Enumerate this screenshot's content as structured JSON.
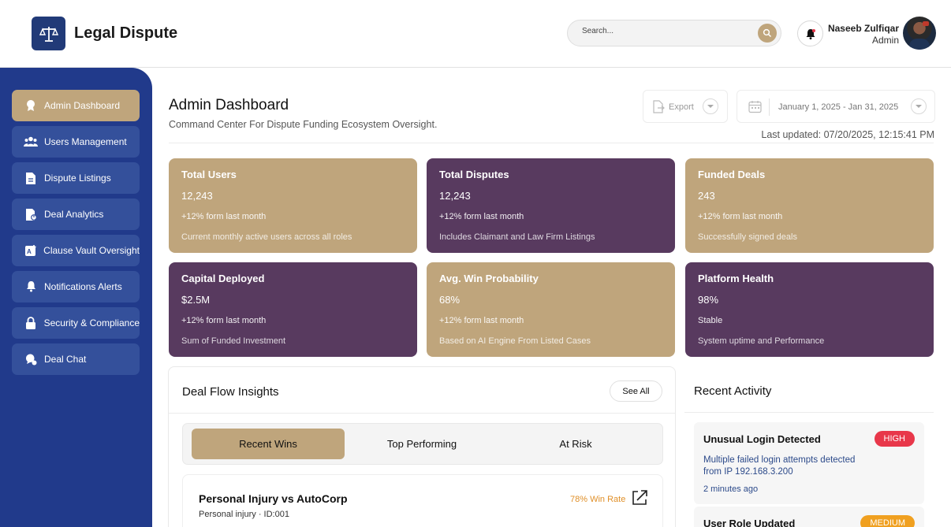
{
  "app": {
    "title": "Legal Dispute"
  },
  "header": {
    "search_placeholder": "Search...",
    "user_name": "Naseeb Zulfiqar",
    "user_role": "Admin"
  },
  "sidebar": {
    "items": [
      {
        "label": "Admin Dashboard",
        "icon": "badge-icon",
        "active": true
      },
      {
        "label": "Users Management",
        "icon": "users-icon"
      },
      {
        "label": "Dispute Listings",
        "icon": "document-icon"
      },
      {
        "label": "Deal Analytics",
        "icon": "analytics-icon"
      },
      {
        "label": "Clause Vault Oversight",
        "icon": "vault-icon"
      },
      {
        "label": "Notifications Alerts",
        "icon": "bell-icon"
      },
      {
        "label": "Security & Compliance",
        "icon": "lock-icon"
      },
      {
        "label": "Deal Chat",
        "icon": "chat-icon"
      }
    ]
  },
  "main": {
    "title": "Admin Dashboard",
    "subtitle": "Command Center For Dispute Funding Ecosystem Oversight.",
    "export_label": "Export",
    "date_range": "January 1, 2025 - Jan 31, 2025",
    "last_updated": "Last updated: 07/20/2025, 12:15:41 PM"
  },
  "cards": [
    {
      "title": "Total Users",
      "value": "12,243",
      "delta": "+12% form last month",
      "desc": "Current monthly active users across all roles",
      "color": "#bfa57c"
    },
    {
      "title": "Total Disputes",
      "value": "12,243",
      "delta": "+12% form last month",
      "desc": "Includes Claimant and Law Firm Listings",
      "color": "#583a5f"
    },
    {
      "title": "Funded Deals",
      "value": "243",
      "delta": "+12% form last month",
      "desc": "Successfully signed deals",
      "color": "#bfa57c"
    },
    {
      "title": "Capital Deployed",
      "value": "$2.5M",
      "delta": "+12% form last month",
      "desc": "Sum of Funded Investment",
      "color": "#583a5f"
    },
    {
      "title": "Avg. Win Probability",
      "value": "68%",
      "delta": "+12% form last month",
      "desc": "Based on AI Engine From Listed Cases",
      "color": "#bfa57c"
    },
    {
      "title": "Platform Health",
      "value": "98%",
      "delta": "Stable",
      "desc": "System uptime and Performance",
      "color": "#583a5f"
    }
  ],
  "deal_flow": {
    "title": "Deal Flow Insights",
    "see_all": "See All",
    "tabs": [
      "Recent Wins",
      "Top Performing",
      "At Risk"
    ],
    "active_tab": "Recent Wins",
    "deal": {
      "title": "Personal Injury vs AutoCorp",
      "subtitle": "Personal injury · ID:001",
      "win_rate": "78% Win Rate"
    }
  },
  "activity": {
    "title": "Recent Activity",
    "items": [
      {
        "title": "Unusual Login Detected",
        "badge": "HIGH",
        "badge_color": "#e8374a",
        "desc": "Multiple failed login attempts detected from IP 192.168.3.200",
        "time": "2 minutes ago"
      },
      {
        "title": "User Role Updated",
        "badge": "MEDIUM",
        "badge_color": "#f0a020"
      }
    ]
  }
}
